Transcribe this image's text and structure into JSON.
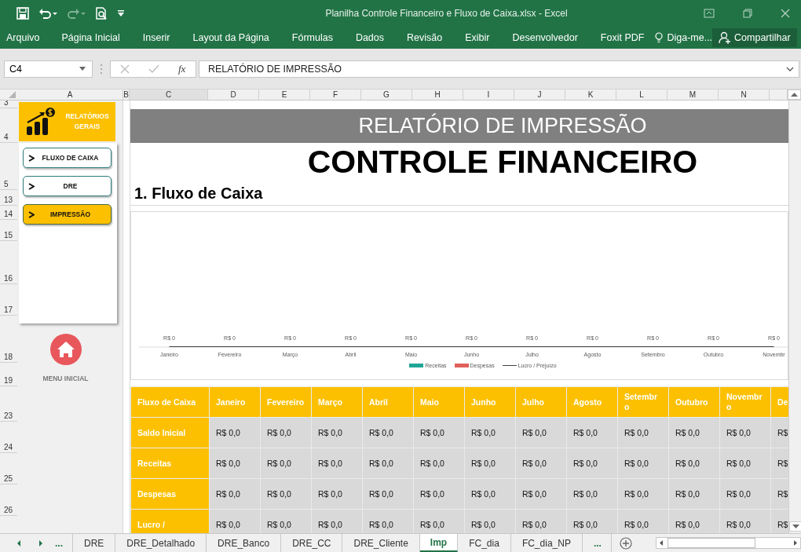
{
  "window": {
    "title": "Planilha Controle Financeiro e Fluxo de Caixa.xlsx - Excel"
  },
  "ribbon": {
    "tabs": [
      "Arquivo",
      "Página Inicial",
      "Inserir",
      "Layout da Página",
      "Fórmulas",
      "Dados",
      "Revisão",
      "Exibir",
      "Desenvolvedor",
      "Foxit PDF"
    ],
    "tell_me": "Diga-me...",
    "share": "Compartilhar"
  },
  "formula_bar": {
    "name_box": "C4",
    "function_label": "fx",
    "value": "RELATÓRIO DE IMPRESSÃO"
  },
  "column_headers": [
    "A",
    "B",
    "C",
    "D",
    "E",
    "F",
    "G",
    "H",
    "I",
    "J",
    "K",
    "L",
    "M",
    "N"
  ],
  "row_headers": [
    "3",
    "4",
    "5",
    "13",
    "14",
    "15",
    "16",
    "17",
    "18",
    "19",
    "23",
    "24",
    "25",
    "26"
  ],
  "sidebar": {
    "title": "RELATÓRIOS GERAIS",
    "buttons": [
      {
        "label": "FLUXO DE CAIXA",
        "selected": false
      },
      {
        "label": "DRE",
        "selected": false
      },
      {
        "label": "IMPRESSÃO",
        "selected": true
      }
    ],
    "home_label": "MENU INICIAL"
  },
  "report": {
    "banner": "RELATÓRIO DE IMPRESSÃO",
    "title": "CONTROLE FINANCEIRO",
    "section": "1. Fluxo de Caixa",
    "chart": {
      "categories": [
        "Janeiro",
        "Fevereiro",
        "Março",
        "Abril",
        "Maio",
        "Junho",
        "Julho",
        "Agosto",
        "Setembro",
        "Outubro",
        "Novembr"
      ],
      "legend": [
        {
          "name": "Receitas",
          "kind": "box",
          "color": "#1fa595"
        },
        {
          "name": "Despesas",
          "kind": "box",
          "color": "#e0605a"
        },
        {
          "name": "Lucro / Prejuízo",
          "kind": "line",
          "color": "#404040"
        }
      ],
      "value_labels": [
        "R$ 0",
        "R$ 0",
        "R$ 0",
        "R$ 0",
        "R$ 0",
        "R$ 0",
        "R$ 0",
        "R$ 0",
        "R$ 0",
        "R$ 0",
        "R$ 0"
      ]
    },
    "table": {
      "columns": [
        "Fluxo de Caixa",
        "Janeiro",
        "Fevereiro",
        "Março",
        "Abril",
        "Maio",
        "Junho",
        "Julho",
        "Agosto",
        "Setembro",
        "Outubro",
        "Novembro",
        "De"
      ],
      "rows": [
        {
          "cells": [
            "Saldo Inicial",
            "R$ 0,0",
            "R$ 0,0",
            "R$ 0,0",
            "R$ 0,0",
            "R$ 0,0",
            "R$ 0,0",
            "R$ 0,0",
            "R$ 0,0",
            "R$ 0,0",
            "R$ 0,0",
            "R$ 0,0",
            "R$"
          ]
        },
        {
          "cells": [
            "Receitas",
            "R$ 0,0",
            "R$ 0,0",
            "R$ 0,0",
            "R$ 0,0",
            "R$ 0,0",
            "R$ 0,0",
            "R$ 0,0",
            "R$ 0,0",
            "R$ 0,0",
            "R$ 0,0",
            "R$ 0,0",
            "R$"
          ]
        },
        {
          "cells": [
            "Despesas",
            "R$ 0,0",
            "R$ 0,0",
            "R$ 0,0",
            "R$ 0,0",
            "R$ 0,0",
            "R$ 0,0",
            "R$ 0,0",
            "R$ 0,0",
            "R$ 0,0",
            "R$ 0,0",
            "R$ 0,0",
            "R$"
          ]
        },
        {
          "cells": [
            "Lucro /",
            "R$ 0,0",
            "R$ 0,0",
            "R$ 0,0",
            "R$ 0,0",
            "R$ 0,0",
            "R$ 0,0",
            "R$ 0,0",
            "R$ 0,0",
            "R$ 0,0",
            "R$ 0,0",
            "R$ 0,0",
            "R$"
          ]
        }
      ]
    }
  },
  "sheet_tabs": [
    {
      "label": "DRE",
      "selected": false
    },
    {
      "label": "DRE_Detalhado",
      "selected": false
    },
    {
      "label": "DRE_Banco",
      "selected": false
    },
    {
      "label": "DRE_CC",
      "selected": false
    },
    {
      "label": "DRE_Cliente",
      "selected": false
    },
    {
      "label": "Imp",
      "selected": true
    },
    {
      "label": "FC_dia",
      "selected": false
    },
    {
      "label": "FC_dia_NP",
      "selected": false
    }
  ],
  "sheet_more": [
    "...",
    "..."
  ]
}
